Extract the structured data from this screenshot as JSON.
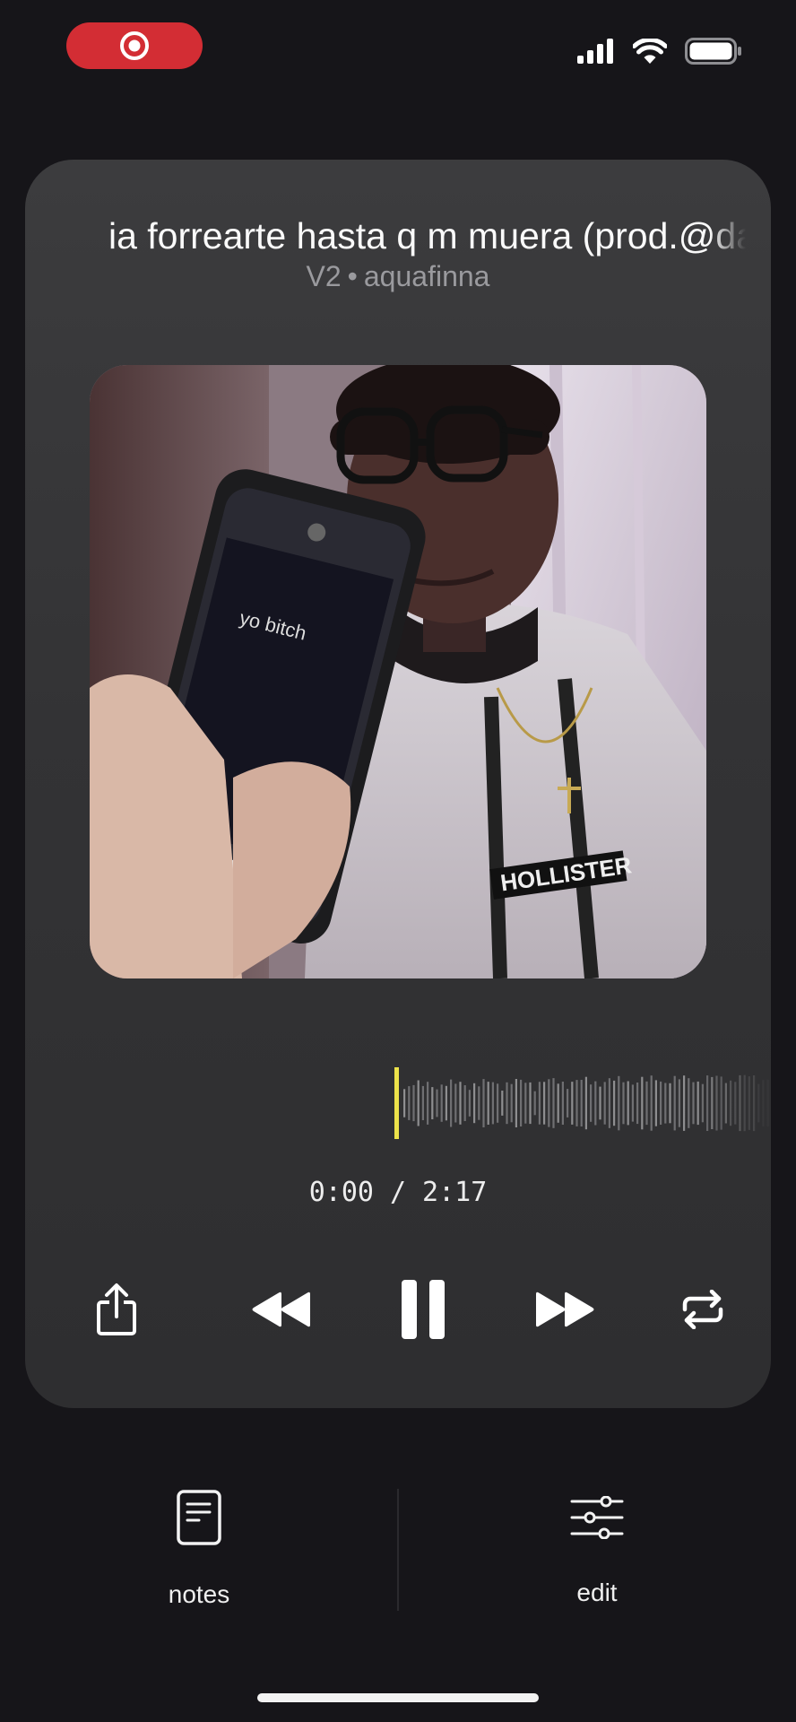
{
  "status_bar": {
    "record_icon": "screen-record-icon",
    "signal_icon": "cellular-signal-icon",
    "wifi_icon": "wifi-icon",
    "battery_icon": "battery-icon",
    "record_color": "#d32d34"
  },
  "player": {
    "title": "ia forrearte hasta q m muera (prod.@da",
    "version": "V2",
    "separator": "•",
    "artist": "aquafinna",
    "artwork_icon": "album-artwork-photo",
    "playhead_color": "#ece24a",
    "progress": 0,
    "current_time": "0:00",
    "time_separator": "/",
    "duration": "2:17",
    "controls": {
      "share_icon": "share-icon",
      "rewind_icon": "rewind-icon",
      "pause_icon": "pause-icon",
      "forward_icon": "fast-forward-icon",
      "repeat_icon": "repeat-icon"
    }
  },
  "bottom_tabs": {
    "notes_label": "notes",
    "notes_icon": "notes-icon",
    "edit_label": "edit",
    "edit_icon": "sliders-icon"
  }
}
